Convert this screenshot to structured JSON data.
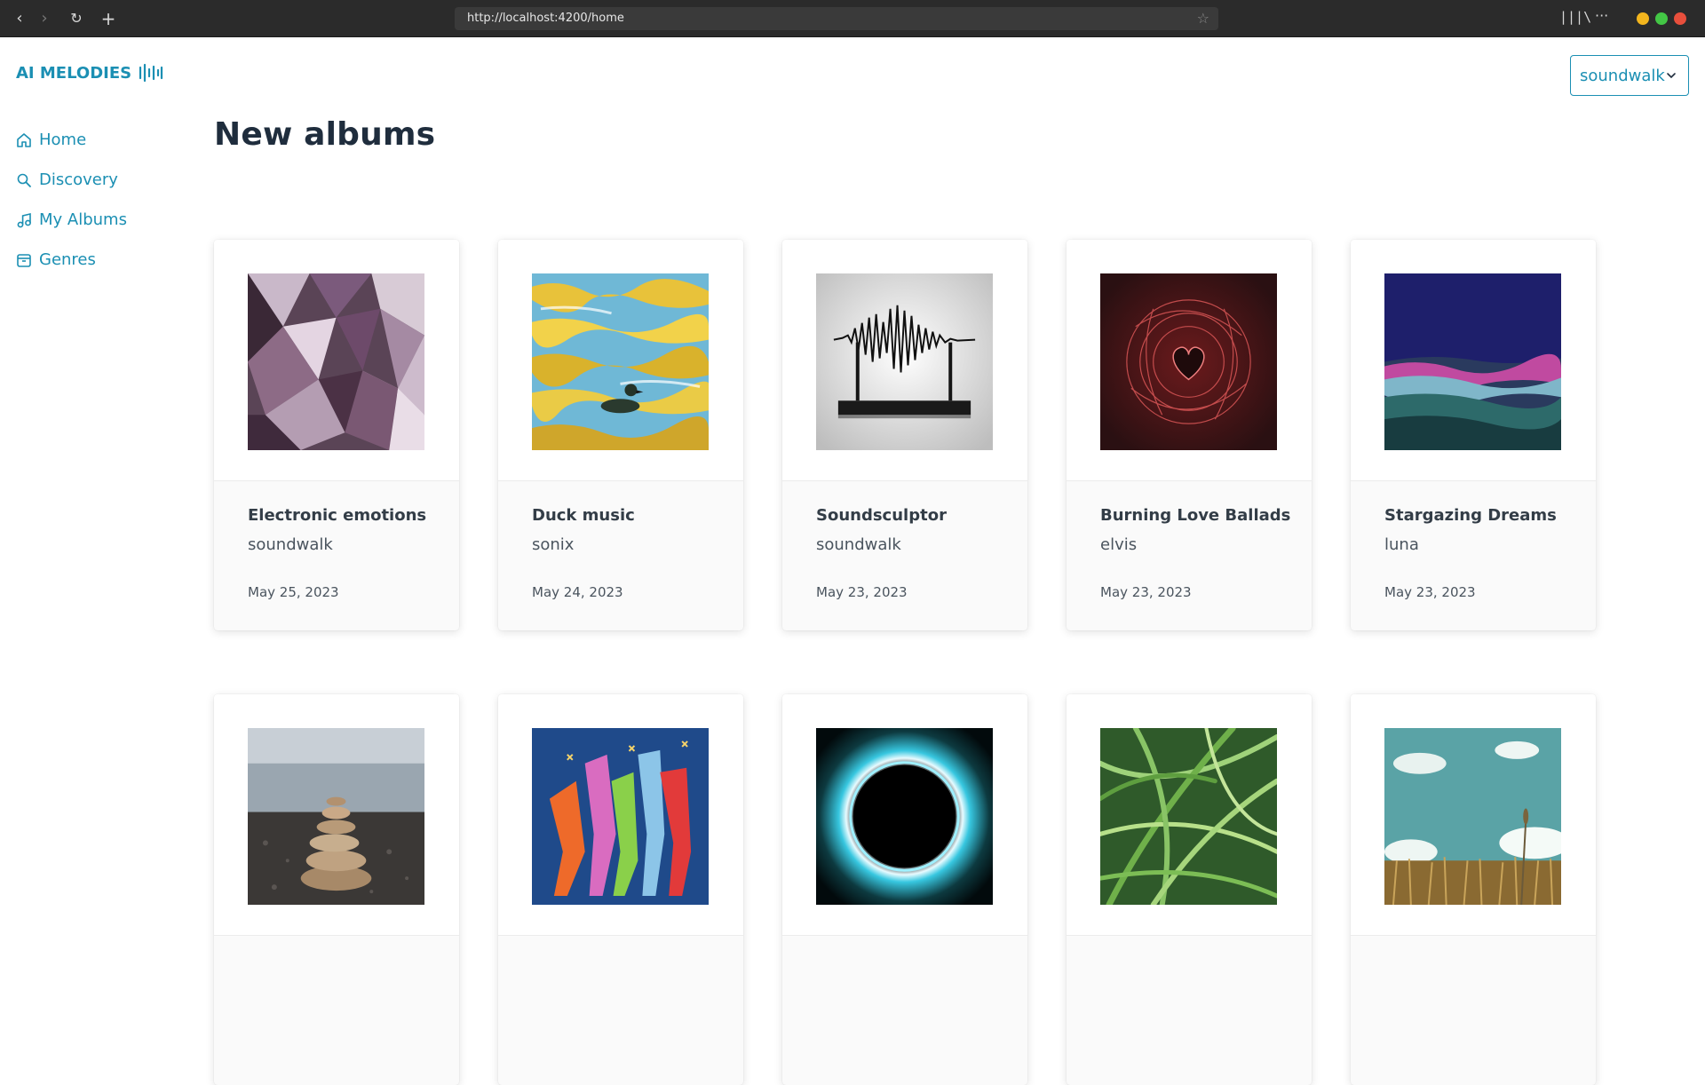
{
  "browser": {
    "url": "http://localhost:4200/home",
    "window_dots": [
      "#f3b51d",
      "#43c645",
      "#e84f3c"
    ]
  },
  "app": {
    "brand": "AI MELODIES",
    "nav": [
      {
        "label": "Home",
        "icon": "home-icon"
      },
      {
        "label": "Discovery",
        "icon": "search-icon"
      },
      {
        "label": "My Albums",
        "icon": "music-note-icon"
      },
      {
        "label": "Genres",
        "icon": "archive-box-icon"
      }
    ],
    "user_menu": {
      "selected": "soundwalk"
    },
    "page_title": "New albums",
    "accent_color": "#1b8fb3"
  },
  "albums": [
    {
      "title": "Electronic emotions",
      "artist": "soundwalk",
      "date": "May 25, 2023",
      "art": "purple-crystal-facets"
    },
    {
      "title": "Duck music",
      "artist": "sonix",
      "date": "May 24, 2023",
      "art": "duck-on-golden-water"
    },
    {
      "title": "Soundsculptor",
      "artist": "soundwalk",
      "date": "May 23, 2023",
      "art": "sound-wave-sculpture"
    },
    {
      "title": "Burning Love Ballads",
      "artist": "elvis",
      "date": "May 23, 2023",
      "art": "red-heart-fractal"
    },
    {
      "title": "Stargazing Dreams",
      "artist": "luna",
      "date": "May 23, 2023",
      "art": "crescent-moon-over-sea"
    },
    {
      "title": "",
      "artist": "",
      "date": "",
      "art": "stacked-stones-beach"
    },
    {
      "title": "",
      "artist": "",
      "date": "",
      "art": "colorful-jazz-band"
    },
    {
      "title": "",
      "artist": "",
      "date": "",
      "art": "glowing-black-hole"
    },
    {
      "title": "",
      "artist": "",
      "date": "",
      "art": "green-grass-blades"
    },
    {
      "title": "",
      "artist": "",
      "date": "",
      "art": "wheat-field-sky"
    }
  ]
}
